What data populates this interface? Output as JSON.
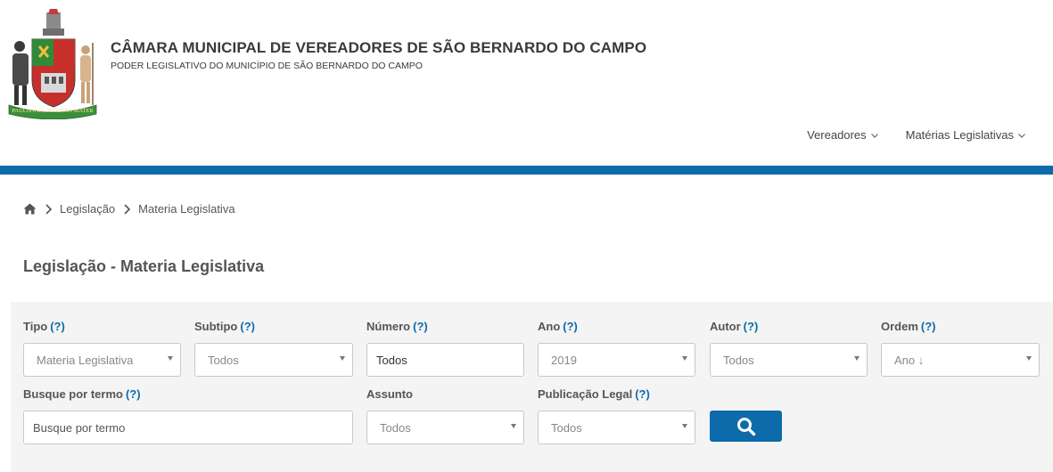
{
  "header": {
    "title": "CÂMARA MUNICIPAL DE VEREADORES DE SÃO BERNARDO DO CAMPO",
    "subtitle": "PODER LEGISLATIVO DO MUNICÍPIO DE SÃO BERNARDO DO CAMPO",
    "logo_motto": "PAULISTARUM TERRA MATER",
    "nav": [
      {
        "label": "Vereadores"
      },
      {
        "label": "Matérias Legislativas"
      }
    ]
  },
  "breadcrumb": {
    "home_icon": "home-icon",
    "items": [
      "Legislação",
      "Materia Legislativa"
    ]
  },
  "page_title": "Legislação - Materia Legislativa",
  "filters": {
    "help_text": "(?)",
    "tipo": {
      "label": "Tipo",
      "value": "Materia Legislativa"
    },
    "subtipo": {
      "label": "Subtipo",
      "value": "Todos"
    },
    "numero": {
      "label": "Número",
      "value": "Todos"
    },
    "ano": {
      "label": "Ano",
      "value": "2019"
    },
    "autor": {
      "label": "Autor",
      "value": "Todos"
    },
    "ordem": {
      "label": "Ordem",
      "value": "Ano ↓"
    },
    "termo": {
      "label": "Busque por termo",
      "placeholder": "Busque por termo"
    },
    "assunto": {
      "label": "Assunto",
      "value": "Todos"
    },
    "publicacao": {
      "label": "Publicação Legal",
      "value": "Todos"
    },
    "search_button_icon": "search-icon"
  },
  "colors": {
    "brand_blue": "#0b6bab",
    "panel_bg": "#f4f4f4",
    "text": "#555555"
  }
}
